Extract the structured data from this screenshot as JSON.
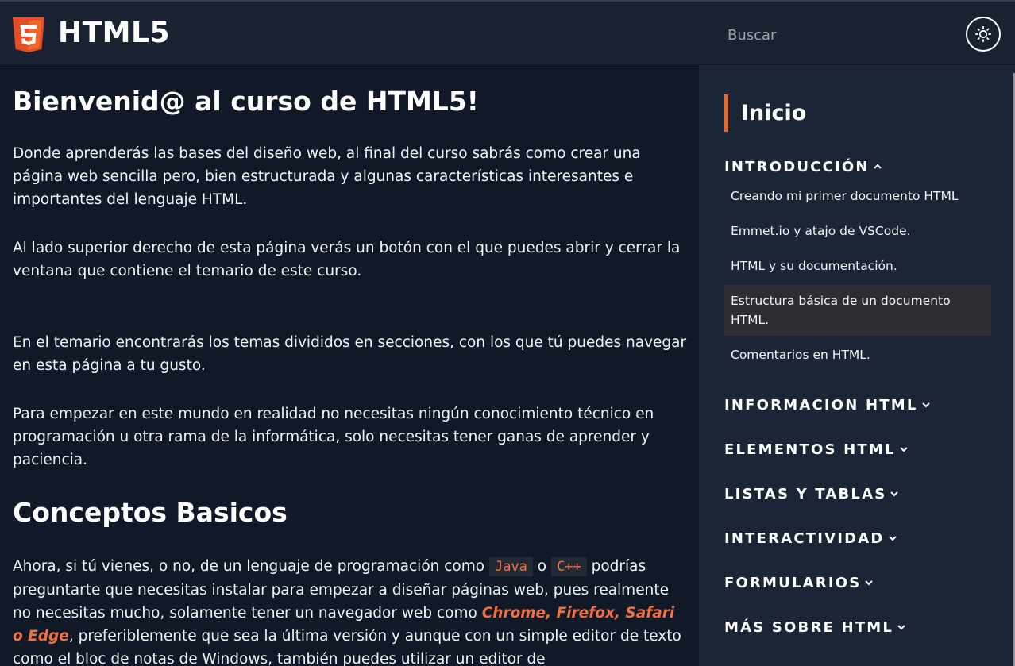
{
  "header": {
    "brand": "HTML5",
    "logo_badge": "5",
    "search_placeholder": "Buscar",
    "theme_icon": "sun-icon"
  },
  "main": {
    "title": "Bienvenid@ al curso de HTML5!",
    "p1": "Donde aprenderás las bases del diseño web, al final del curso sabrás como crear una página web sencilla pero, bien estructurada y algunas características interesantes e importantes del lenguaje HTML.",
    "p2": "Al lado superior derecho de esta página verás un botón con el que puedes abrir y cerrar la ventana que contiene el temario de este curso.",
    "p3": "En el temario encontrarás los temas divididos en secciones, con los que tú puedes navegar en esta página a tu gusto.",
    "p4": "Para empezar en este mundo en realidad no necesitas ningún conocimiento técnico en programación u otra rama de la informática, solo necesitas tener ganas de aprender y paciencia.",
    "subtitle": "Conceptos Basicos",
    "p5": {
      "t1": "Ahora, si tú vienes, o no, de un lenguaje de programación como ",
      "code1": "Java",
      "t2": " o ",
      "code2": "C++",
      "t3": " podrías preguntarte que necesitas instalar para empezar a diseñar páginas web, pues realmente no necesitas mucho, solamente tener un navegador web como ",
      "highlight": "Chrome, Firefox, Safari o Edge",
      "t4": ", preferiblemente que sea la última versión y aunque con un simple editor de texto como el bloc de notas de Windows, también puedes utilizar un editor de"
    }
  },
  "sidebar": {
    "inicio": "Inicio",
    "sections": [
      {
        "label": "INTRODUCCIÓN",
        "expanded": true,
        "items": [
          "Creando mi primer documento HTML",
          "Emmet.io y atajo de VSCode.",
          "HTML y su documentación.",
          "Estructura básica de un documento HTML.",
          "Comentarios en HTML."
        ],
        "active_item": 3
      },
      {
        "label": "INFORMACION HTML",
        "expanded": false
      },
      {
        "label": "ELEMENTOS HTML",
        "expanded": false
      },
      {
        "label": "LISTAS Y TABLAS",
        "expanded": false
      },
      {
        "label": "INTERACTIVIDAD",
        "expanded": false
      },
      {
        "label": "FORMULARIOS",
        "expanded": false
      },
      {
        "label": "MÁS SOBRE HTML",
        "expanded": false
      }
    ]
  },
  "colors": {
    "accent": "#ea6a2c",
    "header_bg": "#1a2232",
    "main_bg": "#111827",
    "sidebar_bg": "#1c2535",
    "active_item_bg": "#2e2d33"
  }
}
